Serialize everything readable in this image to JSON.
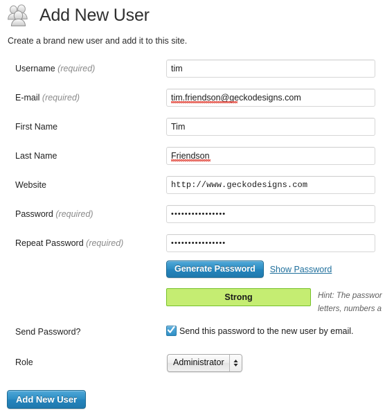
{
  "header": {
    "icon": "users-icon",
    "title": "Add New User",
    "subtitle": "Create a brand new user and add it to this site."
  },
  "form": {
    "required_suffix": "(required)",
    "fields": [
      {
        "label": "Username",
        "required": true,
        "value": "tim",
        "type": "text"
      },
      {
        "label": "E-mail",
        "required": true,
        "value": "tim.friendson@geckodesigns.com",
        "type": "text"
      },
      {
        "label": "First Name",
        "required": false,
        "value": "Tim",
        "type": "text"
      },
      {
        "label": "Last Name",
        "required": false,
        "value": "Friendson",
        "type": "text"
      },
      {
        "label": "Website",
        "required": false,
        "value": "http://www.geckodesigns.com",
        "type": "url"
      },
      {
        "label": "Password",
        "required": true,
        "value": "••••••••••••••••",
        "type": "password"
      },
      {
        "label": "Repeat Password",
        "required": true,
        "value": "••••••••••••••••",
        "type": "password"
      }
    ]
  },
  "password_tools": {
    "generate_label": "Generate Password",
    "show_label": "Show Password"
  },
  "strength": {
    "label": "Strong",
    "color": "#c5ed72",
    "border_color": "#76c12a",
    "hint_line1": "Hint: The passwor",
    "hint_line2": "letters, numbers a"
  },
  "send_password": {
    "label": "Send Password?",
    "checkbox_label": "Send this password to the new user by email.",
    "checked": true
  },
  "role": {
    "label": "Role",
    "selected": "Administrator"
  },
  "submit": {
    "label": "Add New User"
  },
  "colors": {
    "accent_blue": "#2585bd",
    "link_blue": "#1f6f9c",
    "strength_green": "#c5ed72",
    "input_border": "#d6d6d6"
  }
}
